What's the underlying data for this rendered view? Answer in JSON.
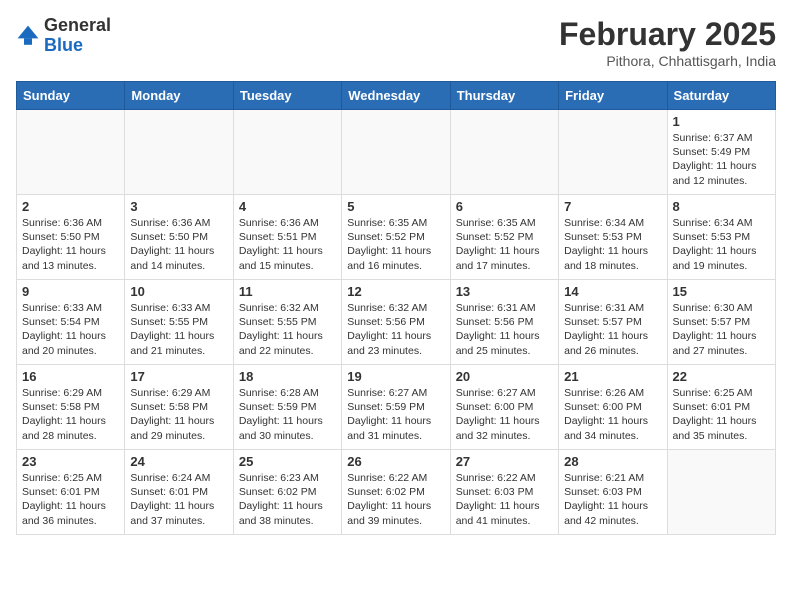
{
  "header": {
    "logo_general": "General",
    "logo_blue": "Blue",
    "month_title": "February 2025",
    "location": "Pithora, Chhattisgarh, India"
  },
  "days_of_week": [
    "Sunday",
    "Monday",
    "Tuesday",
    "Wednesday",
    "Thursday",
    "Friday",
    "Saturday"
  ],
  "weeks": [
    [
      {
        "day": "",
        "info": ""
      },
      {
        "day": "",
        "info": ""
      },
      {
        "day": "",
        "info": ""
      },
      {
        "day": "",
        "info": ""
      },
      {
        "day": "",
        "info": ""
      },
      {
        "day": "",
        "info": ""
      },
      {
        "day": "1",
        "info": "Sunrise: 6:37 AM\nSunset: 5:49 PM\nDaylight: 11 hours\nand 12 minutes."
      }
    ],
    [
      {
        "day": "2",
        "info": "Sunrise: 6:36 AM\nSunset: 5:50 PM\nDaylight: 11 hours\nand 13 minutes."
      },
      {
        "day": "3",
        "info": "Sunrise: 6:36 AM\nSunset: 5:50 PM\nDaylight: 11 hours\nand 14 minutes."
      },
      {
        "day": "4",
        "info": "Sunrise: 6:36 AM\nSunset: 5:51 PM\nDaylight: 11 hours\nand 15 minutes."
      },
      {
        "day": "5",
        "info": "Sunrise: 6:35 AM\nSunset: 5:52 PM\nDaylight: 11 hours\nand 16 minutes."
      },
      {
        "day": "6",
        "info": "Sunrise: 6:35 AM\nSunset: 5:52 PM\nDaylight: 11 hours\nand 17 minutes."
      },
      {
        "day": "7",
        "info": "Sunrise: 6:34 AM\nSunset: 5:53 PM\nDaylight: 11 hours\nand 18 minutes."
      },
      {
        "day": "8",
        "info": "Sunrise: 6:34 AM\nSunset: 5:53 PM\nDaylight: 11 hours\nand 19 minutes."
      }
    ],
    [
      {
        "day": "9",
        "info": "Sunrise: 6:33 AM\nSunset: 5:54 PM\nDaylight: 11 hours\nand 20 minutes."
      },
      {
        "day": "10",
        "info": "Sunrise: 6:33 AM\nSunset: 5:55 PM\nDaylight: 11 hours\nand 21 minutes."
      },
      {
        "day": "11",
        "info": "Sunrise: 6:32 AM\nSunset: 5:55 PM\nDaylight: 11 hours\nand 22 minutes."
      },
      {
        "day": "12",
        "info": "Sunrise: 6:32 AM\nSunset: 5:56 PM\nDaylight: 11 hours\nand 23 minutes."
      },
      {
        "day": "13",
        "info": "Sunrise: 6:31 AM\nSunset: 5:56 PM\nDaylight: 11 hours\nand 25 minutes."
      },
      {
        "day": "14",
        "info": "Sunrise: 6:31 AM\nSunset: 5:57 PM\nDaylight: 11 hours\nand 26 minutes."
      },
      {
        "day": "15",
        "info": "Sunrise: 6:30 AM\nSunset: 5:57 PM\nDaylight: 11 hours\nand 27 minutes."
      }
    ],
    [
      {
        "day": "16",
        "info": "Sunrise: 6:29 AM\nSunset: 5:58 PM\nDaylight: 11 hours\nand 28 minutes."
      },
      {
        "day": "17",
        "info": "Sunrise: 6:29 AM\nSunset: 5:58 PM\nDaylight: 11 hours\nand 29 minutes."
      },
      {
        "day": "18",
        "info": "Sunrise: 6:28 AM\nSunset: 5:59 PM\nDaylight: 11 hours\nand 30 minutes."
      },
      {
        "day": "19",
        "info": "Sunrise: 6:27 AM\nSunset: 5:59 PM\nDaylight: 11 hours\nand 31 minutes."
      },
      {
        "day": "20",
        "info": "Sunrise: 6:27 AM\nSunset: 6:00 PM\nDaylight: 11 hours\nand 32 minutes."
      },
      {
        "day": "21",
        "info": "Sunrise: 6:26 AM\nSunset: 6:00 PM\nDaylight: 11 hours\nand 34 minutes."
      },
      {
        "day": "22",
        "info": "Sunrise: 6:25 AM\nSunset: 6:01 PM\nDaylight: 11 hours\nand 35 minutes."
      }
    ],
    [
      {
        "day": "23",
        "info": "Sunrise: 6:25 AM\nSunset: 6:01 PM\nDaylight: 11 hours\nand 36 minutes."
      },
      {
        "day": "24",
        "info": "Sunrise: 6:24 AM\nSunset: 6:01 PM\nDaylight: 11 hours\nand 37 minutes."
      },
      {
        "day": "25",
        "info": "Sunrise: 6:23 AM\nSunset: 6:02 PM\nDaylight: 11 hours\nand 38 minutes."
      },
      {
        "day": "26",
        "info": "Sunrise: 6:22 AM\nSunset: 6:02 PM\nDaylight: 11 hours\nand 39 minutes."
      },
      {
        "day": "27",
        "info": "Sunrise: 6:22 AM\nSunset: 6:03 PM\nDaylight: 11 hours\nand 41 minutes."
      },
      {
        "day": "28",
        "info": "Sunrise: 6:21 AM\nSunset: 6:03 PM\nDaylight: 11 hours\nand 42 minutes."
      },
      {
        "day": "",
        "info": ""
      }
    ]
  ]
}
